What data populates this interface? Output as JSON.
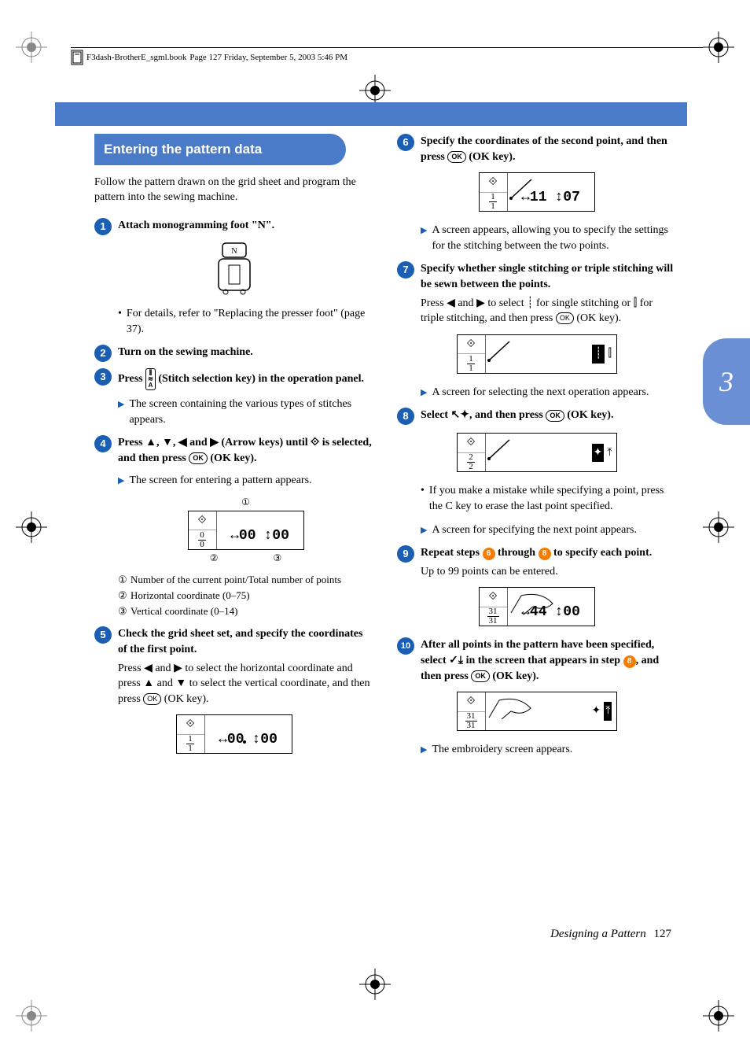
{
  "header": {
    "filename": "F3dash-BrotherE_sgml.book",
    "page_info": "Page 127  Friday, September 5, 2003  5:46 PM"
  },
  "side_tab": "3",
  "section_title": "Entering the pattern data",
  "intro": "Follow the pattern drawn on the grid sheet and program the pattern into the sewing machine.",
  "steps": {
    "s1": {
      "num": "1",
      "title": "Attach monogramming foot \"N\"."
    },
    "s1_detail": "For details, refer to \"Replacing the presser foot\" (page 37).",
    "s2": {
      "num": "2",
      "title": "Turn on the sewing machine."
    },
    "s3": {
      "num": "3",
      "title_pre": "Press ",
      "title_post": " (Stitch selection key) in the operation panel."
    },
    "s3_result": "The screen containing the various types of stitches appears.",
    "s4": {
      "num": "4",
      "title_a": "Press ",
      "title_b": " (Arrow keys) until ",
      "title_c": " is selected, and then press ",
      "title_d": " (OK key)."
    },
    "s4_result": "The screen for entering a pattern appears.",
    "annot1": "Number of the current point/Total number of points",
    "annot2": "Horizontal coordinate (0–75)",
    "annot3": "Vertical coordinate (0–14)",
    "s5": {
      "num": "5",
      "title": "Check the grid sheet set, and specify the coordinates of the first point."
    },
    "s5_text_a": "Press ",
    "s5_text_b": " and ",
    "s5_text_c": " to select the horizontal coordinate and press ",
    "s5_text_d": " and ",
    "s5_text_e": " to select the vertical coordinate, and then press ",
    "s5_text_f": " (OK key).",
    "s6": {
      "num": "6",
      "title_a": "Specify the coordinates of the second point, and then press ",
      "title_b": " (OK key)."
    },
    "s6_result": "A screen appears, allowing you to specify the settings for the stitching between the two points.",
    "s7": {
      "num": "7",
      "title": "Specify whether single stitching or triple stitching will be sewn between the points."
    },
    "s7_text_a": "Press ",
    "s7_text_b": " and ",
    "s7_text_c": " to select ",
    "s7_text_d": " for single stitching or ",
    "s7_text_e": " for triple stitching, and then press ",
    "s7_text_f": " (OK key).",
    "s7_result": "A screen for selecting the next operation appears.",
    "s8": {
      "num": "8",
      "title_a": "Select ",
      "title_b": ", and then press ",
      "title_c": " (OK key)."
    },
    "s8_bullet": "If you make a mistake while specifying a point, press the C key to erase the last point specified.",
    "s8_result": "A screen for specifying the next point appears.",
    "s9": {
      "num": "9",
      "title_a": "Repeat steps ",
      "title_b": " through ",
      "title_c": " to specify each point."
    },
    "s9_text": "Up to 99 points can be entered.",
    "s10": {
      "num": "10",
      "title_a": "After all points in the pattern have been specified, select ",
      "title_b": " in the screen that appears in step ",
      "title_c": ", and then press ",
      "title_d": " (OK key)."
    },
    "s10_result": "The embroidery screen appears."
  },
  "lcd": {
    "d1": {
      "frac_top": "0",
      "frac_bot": "0",
      "h": "↔00",
      "v": "↕00"
    },
    "d2": {
      "frac_top": "1",
      "frac_bot": "1",
      "h": "↔00",
      "v": "↕00"
    },
    "d3": {
      "frac_top": "1",
      "frac_bot": "1",
      "h": "↔11",
      "v": "↕07"
    },
    "d4": {
      "frac_top": "1",
      "frac_bot": "1"
    },
    "d5": {
      "frac_top": "2",
      "frac_bot": "2"
    },
    "d6": {
      "frac_top": "31",
      "frac_bot": "31",
      "h": "↔44",
      "v": "↕00"
    },
    "d7": {
      "frac_top": "31",
      "frac_bot": "31"
    }
  },
  "inline_refs": {
    "ref6": "6",
    "ref8": "8"
  },
  "footer": {
    "title": "Designing a Pattern",
    "page": "127"
  }
}
